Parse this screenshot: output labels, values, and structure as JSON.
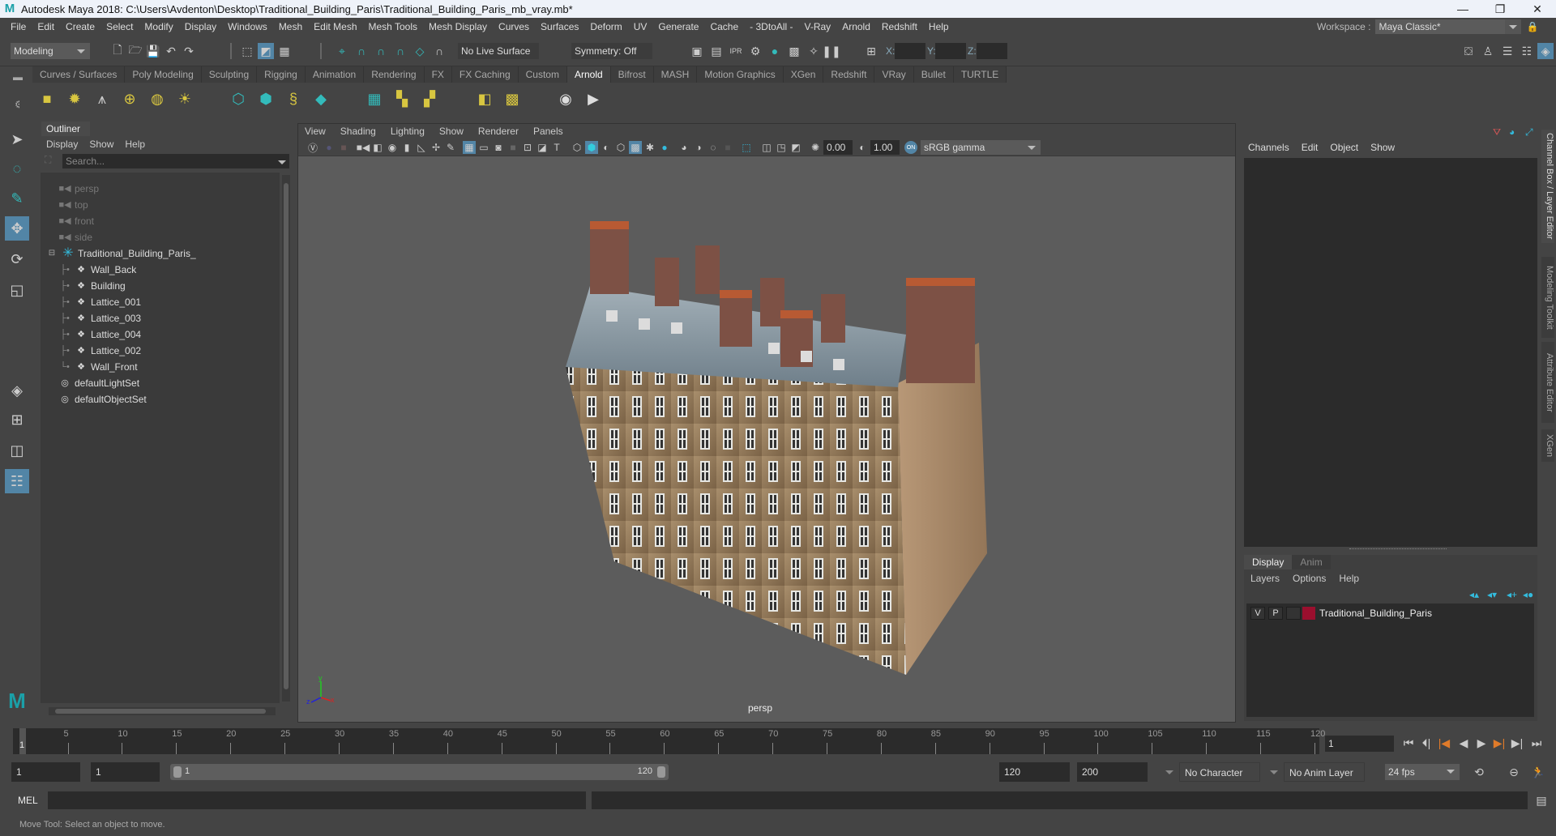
{
  "window": {
    "title": "Autodesk Maya 2018: C:\\Users\\Avdenton\\Desktop\\Traditional_Building_Paris\\Traditional_Building_Paris_mb_vray.mb*",
    "minimize": "—",
    "maximize": "❐",
    "close": "✕"
  },
  "menubar": {
    "items": [
      "File",
      "Edit",
      "Create",
      "Select",
      "Modify",
      "Display",
      "Windows",
      "Mesh",
      "Edit Mesh",
      "Mesh Tools",
      "Mesh Display",
      "Curves",
      "Surfaces",
      "Deform",
      "UV",
      "Generate",
      "Cache",
      "- 3DtoAll -",
      "V-Ray",
      "Arnold",
      "Redshift",
      "Help"
    ],
    "workspace_label": "Workspace :",
    "workspace_value": "Maya Classic*"
  },
  "statusline": {
    "menuset": "Modeling",
    "live_surface": "No Live Surface",
    "symmetry": "Symmetry: Off",
    "x_label": "X:",
    "y_label": "Y:",
    "z_label": "Z:",
    "x_value": "",
    "y_value": "",
    "z_value": ""
  },
  "shelf": {
    "tabs": [
      "Curves / Surfaces",
      "Poly Modeling",
      "Sculpting",
      "Rigging",
      "Animation",
      "Rendering",
      "FX",
      "FX Caching",
      "Custom",
      "Arnold",
      "Bifrost",
      "MASH",
      "Motion Graphics",
      "XGen",
      "Redshift",
      "VRay",
      "Bullet",
      "TURTLE"
    ],
    "active_tab": "Arnold"
  },
  "outliner": {
    "tab": "Outliner",
    "menus": [
      "Display",
      "Show",
      "Help"
    ],
    "search_placeholder": "Search...",
    "items": [
      {
        "label": "persp",
        "type": "camera",
        "depth": 1
      },
      {
        "label": "top",
        "type": "camera",
        "depth": 1
      },
      {
        "label": "front",
        "type": "camera",
        "depth": 1
      },
      {
        "label": "side",
        "type": "camera",
        "depth": 1
      },
      {
        "label": "Traditional_Building_Paris_",
        "type": "group",
        "depth": 0,
        "expanded": true
      },
      {
        "label": "Wall_Back",
        "type": "mesh",
        "depth": 2
      },
      {
        "label": "Building",
        "type": "mesh",
        "depth": 2
      },
      {
        "label": "Lattice_001",
        "type": "mesh",
        "depth": 2
      },
      {
        "label": "Lattice_003",
        "type": "mesh",
        "depth": 2
      },
      {
        "label": "Lattice_004",
        "type": "mesh",
        "depth": 2
      },
      {
        "label": "Lattice_002",
        "type": "mesh",
        "depth": 2
      },
      {
        "label": "Wall_Front",
        "type": "mesh",
        "depth": 2
      },
      {
        "label": "defaultLightSet",
        "type": "set",
        "depth": 1
      },
      {
        "label": "defaultObjectSet",
        "type": "set",
        "depth": 1
      }
    ]
  },
  "viewport": {
    "menus": [
      "View",
      "Shading",
      "Lighting",
      "Show",
      "Renderer",
      "Panels"
    ],
    "exposure": "0.00",
    "gamma": "1.00",
    "color_mgmt_badge": "ON",
    "view_transform": "sRGB gamma",
    "camera_label": "persp",
    "axis": {
      "x": "x",
      "y": "y",
      "z": "z"
    }
  },
  "channelbox": {
    "menus": [
      "Channels",
      "Edit",
      "Object",
      "Show"
    ],
    "layer_tabs": [
      "Display",
      "Anim"
    ],
    "active_layer_tab": "Display",
    "layer_menus": [
      "Layers",
      "Options",
      "Help"
    ],
    "layers": [
      {
        "v": "V",
        "p": "P",
        "r": "",
        "color": "#9b0f2e",
        "name": "Traditional_Building_Paris"
      }
    ]
  },
  "sidetabs": [
    "Channel Box / Layer Editor",
    "Modeling Toolkit",
    "Attribute Editor",
    "XGen"
  ],
  "timeline": {
    "ticks": [
      5,
      10,
      15,
      20,
      25,
      30,
      35,
      40,
      45,
      50,
      55,
      60,
      65,
      70,
      75,
      80,
      85,
      90,
      95,
      100,
      105,
      110,
      115,
      120
    ],
    "range_start": 1,
    "range_end": 120,
    "current_frame_marker": "1",
    "current_frame": "1"
  },
  "rangebar": {
    "start_time": "1",
    "playback_start": "1",
    "range_min_label": "1",
    "range_max_label": "120",
    "playback_end": "120",
    "end_time": "200",
    "character_set": "No Character Set",
    "anim_layer": "No Anim Layer",
    "fps": "24 fps"
  },
  "command": {
    "language": "MEL",
    "input": "",
    "output": ""
  },
  "helpline": {
    "text": "Move Tool: Select an object to move."
  },
  "colors": {
    "accent": "#5285a6",
    "teal": "#27a3ad",
    "layer_color": "#9b0f2e",
    "keyframe_orange": "#e07b2a"
  }
}
